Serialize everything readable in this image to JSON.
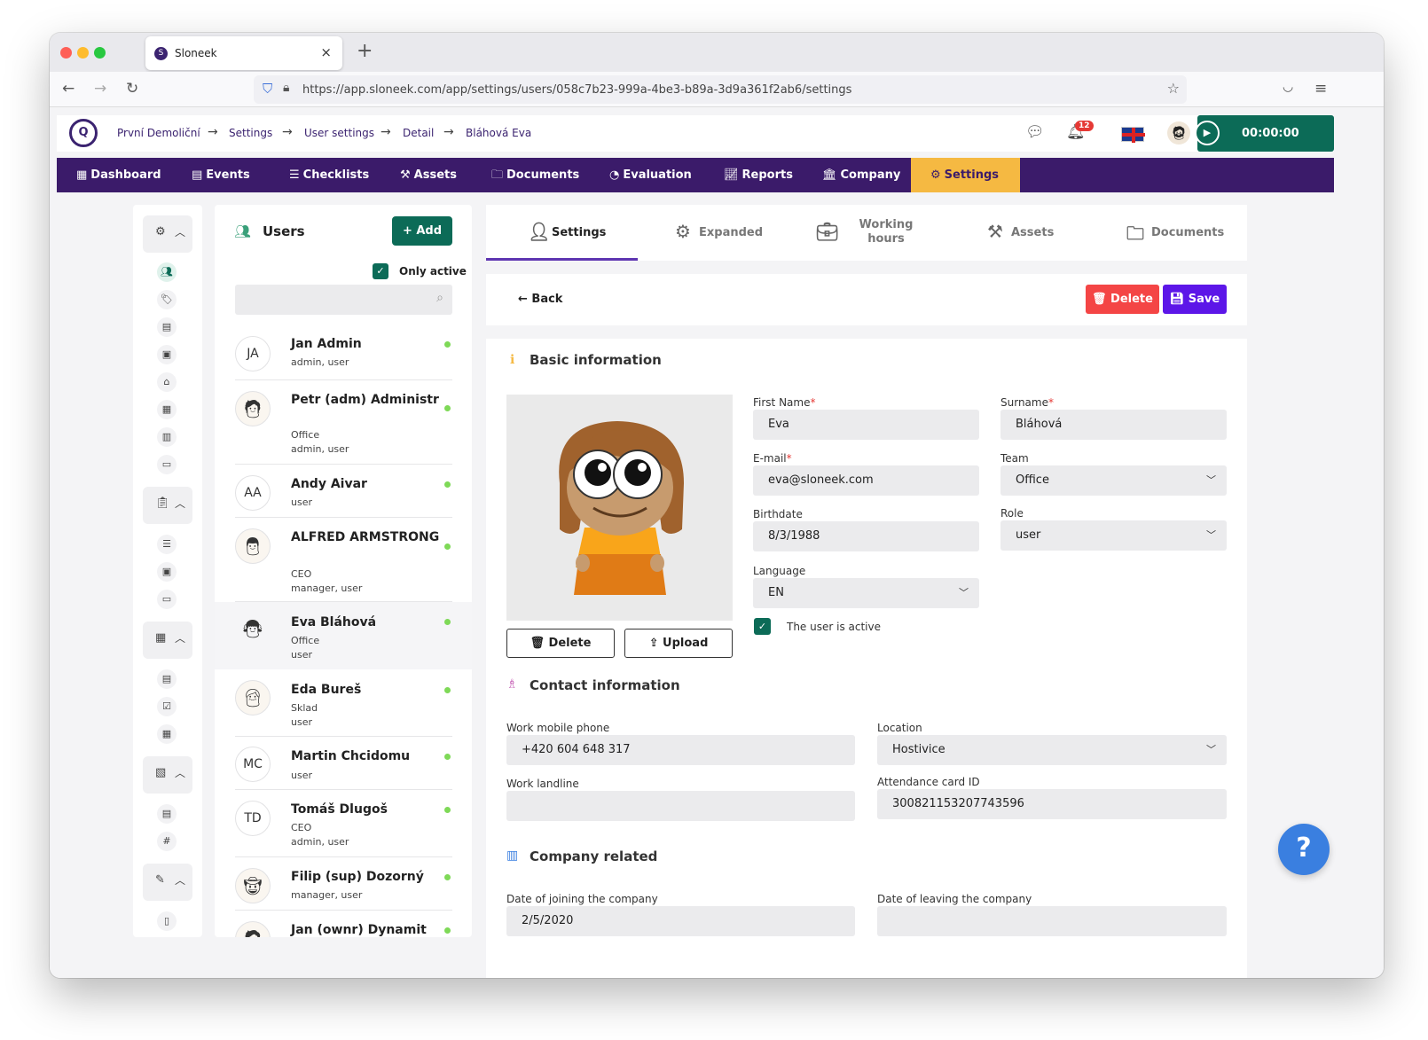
{
  "browser": {
    "tab_title": "Sloneek",
    "url": "https://app.sloneek.com/app/settings/users/058c7b23-999a-4be3-b89a-3d9a361f2ab6/settings"
  },
  "header": {
    "breadcrumb": [
      "První Demoliční",
      "Settings",
      "User settings",
      "Detail",
      "Bláhová Eva"
    ],
    "notifications_count": "12",
    "timer": "00:00:00"
  },
  "nav": [
    "Dashboard",
    "Events",
    "Checklists",
    "Assets",
    "Documents",
    "Evaluation",
    "Reports",
    "Company",
    "Settings"
  ],
  "users_panel": {
    "title": "Users",
    "add_label": "+ Add",
    "only_active_label": "Only active",
    "users": [
      {
        "initials": "JA",
        "name": "Jan Admin",
        "sub": [
          "admin, user"
        ]
      },
      {
        "initials": "",
        "name": "Petr (adm) Administr",
        "sub": [
          "Office",
          "admin, user"
        ]
      },
      {
        "initials": "AA",
        "name": "Andy Aivar",
        "sub": [
          "user"
        ]
      },
      {
        "initials": "",
        "name": "ALFRED ARMSTRONG",
        "sub": [
          "CEO",
          "manager, user"
        ]
      },
      {
        "initials": "",
        "name": "Eva Bláhová",
        "sub": [
          "Office",
          "user"
        ]
      },
      {
        "initials": "",
        "name": "Eda Bureš",
        "sub": [
          "Sklad",
          "user"
        ]
      },
      {
        "initials": "MC",
        "name": "Martin Chcidomu",
        "sub": [
          "user"
        ]
      },
      {
        "initials": "TD",
        "name": "Tomáš Dlugoš",
        "sub": [
          "CEO",
          "admin, user"
        ]
      },
      {
        "initials": "",
        "name": "Filip (sup) Dozorný",
        "sub": [
          "manager, user"
        ]
      },
      {
        "initials": "",
        "name": "Jan (ownr) Dynamit",
        "sub": []
      }
    ]
  },
  "tabs": {
    "settings": "Settings",
    "expanded": "Expanded",
    "working_hours": "Working hours",
    "assets": "Assets",
    "documents": "Documents"
  },
  "actions": {
    "back": "Back",
    "delete": "Delete",
    "save": "Save"
  },
  "basic": {
    "title": "Basic information",
    "photo_delete": "Delete",
    "photo_upload": "Upload",
    "first_name_label": "First Name",
    "first_name": "Eva",
    "surname_label": "Surname",
    "surname": "Bláhová",
    "email_label": "E-mail",
    "email": "eva@sloneek.com",
    "team_label": "Team",
    "team": "Office",
    "birthdate_label": "Birthdate",
    "birthdate": "8/3/1988",
    "role_label": "Role",
    "role": "user",
    "language_label": "Language",
    "language": "EN",
    "active_label": "The user is active"
  },
  "contact": {
    "title": "Contact information",
    "mobile_label": "Work mobile phone",
    "mobile": "+420 604 648 317",
    "location_label": "Location",
    "location": "Hostivice",
    "landline_label": "Work landline",
    "landline": "",
    "card_label": "Attendance card ID",
    "card": "300821153207743596"
  },
  "company": {
    "title": "Company related",
    "join_label": "Date of joining the company",
    "join": "2/5/2020",
    "leave_label": "Date of leaving the company",
    "leave": ""
  },
  "help": "?"
}
